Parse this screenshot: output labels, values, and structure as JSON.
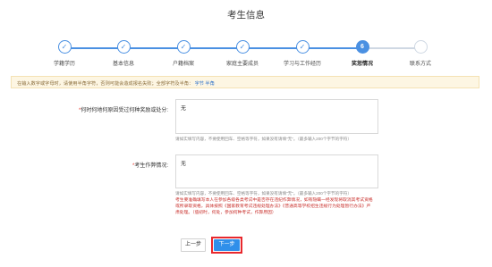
{
  "page": {
    "title": "考生信息"
  },
  "steps": [
    {
      "label": "学籍学历",
      "state": "done"
    },
    {
      "label": "基本信息",
      "state": "done"
    },
    {
      "label": "户籍档案",
      "state": "done"
    },
    {
      "label": "家庭主要成员",
      "state": "done"
    },
    {
      "label": "学习与工作经历",
      "state": "done"
    },
    {
      "label": "奖惩情况",
      "state": "active",
      "number": "6"
    },
    {
      "label": "联系方式",
      "state": "todo"
    }
  ],
  "notice": {
    "text": "在输入数字或字母时，请使用半角字符，否则可能会造成报名失败；全部字符及半角：",
    "link": "字节 半角"
  },
  "form": {
    "award": {
      "label": "何时何地何原因受过何种奖励或处分:",
      "value": "无",
      "hint": "请如实填写内容，不要使用回车、空格等字符，如果没有请填\"无\"。（最多输入200个字节的字符）"
    },
    "cheating": {
      "label": "考生作弊情况:",
      "value": "无",
      "hint": "请如实填写内容，不要使用回车、空格等字符，如果没有请填\"无\"。（最多输入200个字节的字符）",
      "warning": "考生要准确填写本人在参加各级各类考试中是否存在违纪作弊情况，如有隐瞒一经发现将取消其考试资格或所录取资格，具体按照《国家教育考试违规处理办法》《普通高等学校招生违规行为处理暂行办法》严肃处理。（值初时，何处，参加何种考试，作弊原因）"
    }
  },
  "buttons": {
    "prev": "上一步",
    "next": "下一步"
  },
  "colors": {
    "accent": "#4a90e2",
    "highlight_border": "#e8282d",
    "warning_text": "#c9302c",
    "notice_bg": "#fdf6e3"
  }
}
